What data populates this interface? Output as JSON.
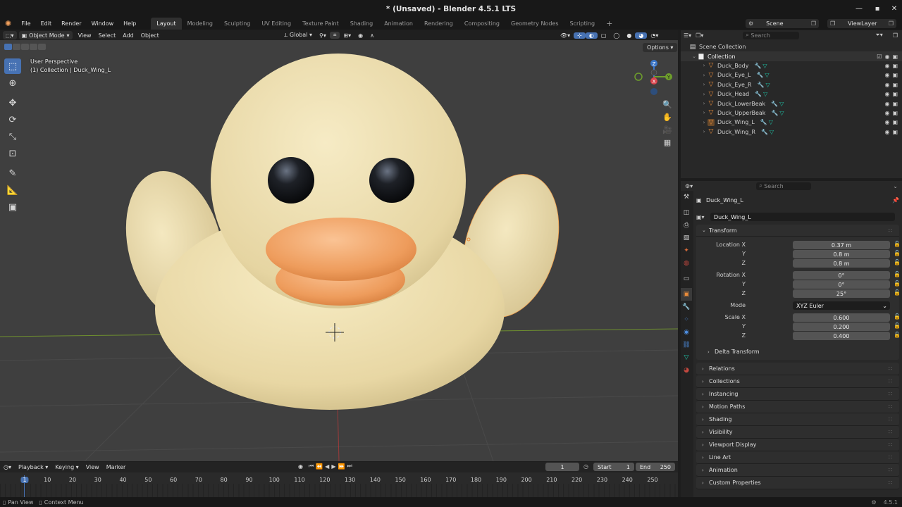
{
  "window": {
    "title": "* (Unsaved) - Blender 4.5.1 LTS",
    "version": "4.5.1"
  },
  "menus": [
    "File",
    "Edit",
    "Render",
    "Window",
    "Help"
  ],
  "workspaces": [
    "Layout",
    "Modeling",
    "Sculpting",
    "UV Editing",
    "Texture Paint",
    "Shading",
    "Animation",
    "Rendering",
    "Compositing",
    "Geometry Nodes",
    "Scripting"
  ],
  "active_workspace": "Layout",
  "topbar_right": {
    "scene": "Scene",
    "view_layer": "ViewLayer"
  },
  "viewport_header": {
    "mode": "Object Mode",
    "menus": [
      "View",
      "Select",
      "Add",
      "Object"
    ],
    "orientation": "Global",
    "options": "Options"
  },
  "viewport_overlay": {
    "perspective": "User Perspective",
    "collection_info": "(1) Collection | Duck_Wing_L"
  },
  "gizmo": {
    "z": "Z",
    "y": "Y",
    "x": "X"
  },
  "outliner": {
    "search_placeholder": "Search",
    "scene_collection": "Scene Collection",
    "collection": "Collection",
    "objects": [
      "Duck_Body",
      "Duck_Eye_L",
      "Duck_Eye_R",
      "Duck_Head",
      "Duck_LowerBeak",
      "Duck_UpperBeak",
      "Duck_Wing_L",
      "Duck_Wing_R"
    ],
    "selected": "Duck_Wing_L"
  },
  "properties": {
    "search_placeholder": "Search",
    "object_name": "Duck_Wing_L",
    "object_field": "Duck_Wing_L",
    "transform_title": "Transform",
    "location_label": "Location X",
    "rotation_label": "Rotation X",
    "scale_label": "Scale X",
    "y_label": "Y",
    "z_label": "Z",
    "mode_label": "Mode",
    "location": [
      "0.37 m",
      "0.8 m",
      "0.8 m"
    ],
    "rotation": [
      "0°",
      "0°",
      "25°"
    ],
    "mode": "XYZ Euler",
    "scale": [
      "0.600",
      "0.200",
      "0.400"
    ],
    "delta_transform": "Delta Transform",
    "panels": [
      "Relations",
      "Collections",
      "Instancing",
      "Motion Paths",
      "Shading",
      "Visibility",
      "Viewport Display",
      "Line Art",
      "Animation",
      "Custom Properties"
    ]
  },
  "timeline": {
    "menus": [
      "Playback",
      "Keying",
      "View",
      "Marker"
    ],
    "current_frame": "1",
    "start_label": "Start",
    "start": "1",
    "end_label": "End",
    "end": "250",
    "ticks": [
      "1",
      "10",
      "20",
      "30",
      "40",
      "50",
      "60",
      "70",
      "80",
      "90",
      "100",
      "110",
      "120",
      "130",
      "140",
      "150",
      "160",
      "170",
      "180",
      "190",
      "200",
      "210",
      "220",
      "230",
      "240",
      "250"
    ]
  },
  "statusbar": {
    "pan_view": "Pan View",
    "context_menu": "Context Menu",
    "version": "4.5.1"
  },
  "colors": {
    "accent": "#4772b3",
    "duck_body": "#efe2b4",
    "beak": "#f0a568",
    "grid_x": "#9a3b3b",
    "grid_y": "#6e8f2f"
  }
}
